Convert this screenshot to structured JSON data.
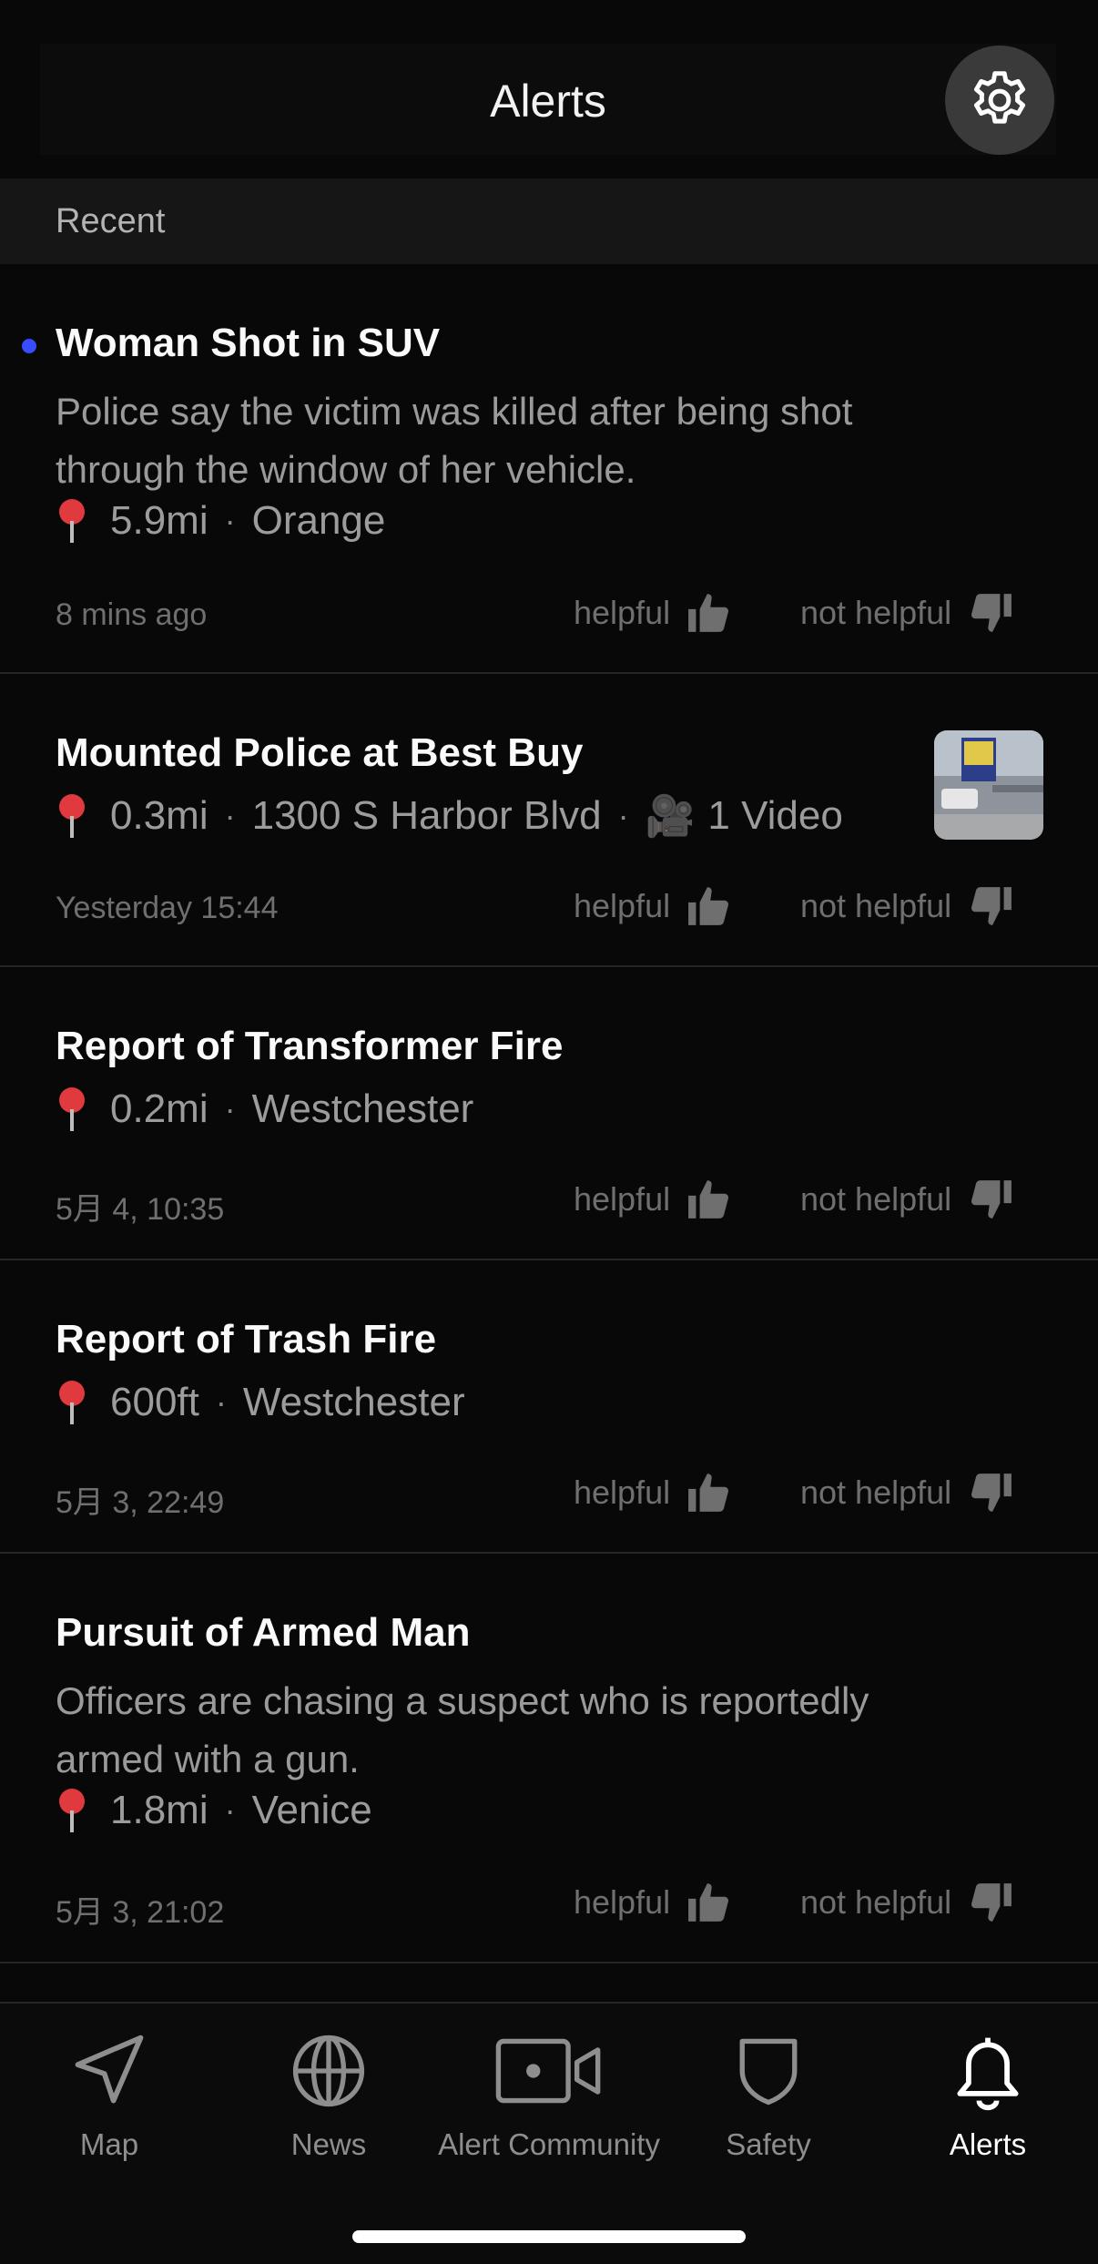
{
  "header": {
    "title": "Alerts",
    "settings_icon": "gear-icon"
  },
  "section": {
    "label": "Recent"
  },
  "feedback": {
    "helpful": "helpful",
    "not_helpful": "not helpful"
  },
  "alerts": [
    {
      "title": "Woman Shot in SUV",
      "unread": true,
      "description": "Police say the victim was killed after being shot through the window of her vehicle.",
      "distance": "5.9mi",
      "place": "Orange",
      "time": "8 mins ago"
    },
    {
      "title": "Mounted Police at Best Buy",
      "distance": "0.3mi",
      "place": "1300 S Harbor Blvd",
      "media": "1 Video",
      "time": "Yesterday 15:44"
    },
    {
      "title": "Report of Transformer Fire",
      "distance": "0.2mi",
      "place": "Westchester",
      "time": "5月 4, 10:35"
    },
    {
      "title": "Report of Trash Fire",
      "distance": "600ft",
      "place": "Westchester",
      "time": "5月 3, 22:49"
    },
    {
      "title": "Pursuit of Armed Man",
      "description": "Officers are chasing a suspect who is reportedly armed with a gun.",
      "distance": "1.8mi",
      "place": "Venice",
      "time": "5月 3, 21:02"
    }
  ],
  "tabs": [
    {
      "label": "Map",
      "icon": "navigation-arrow-icon"
    },
    {
      "label": "News",
      "icon": "globe-icon"
    },
    {
      "label": "Alert Community",
      "icon": "video-camera-icon"
    },
    {
      "label": "Safety",
      "icon": "shield-icon"
    },
    {
      "label": "Alerts",
      "icon": "bell-icon",
      "active": true
    }
  ],
  "colors": {
    "background": "#080808",
    "unread_dot": "#3a4cff",
    "pin": "#e0393e",
    "settings_button": "#3a3a3a"
  }
}
